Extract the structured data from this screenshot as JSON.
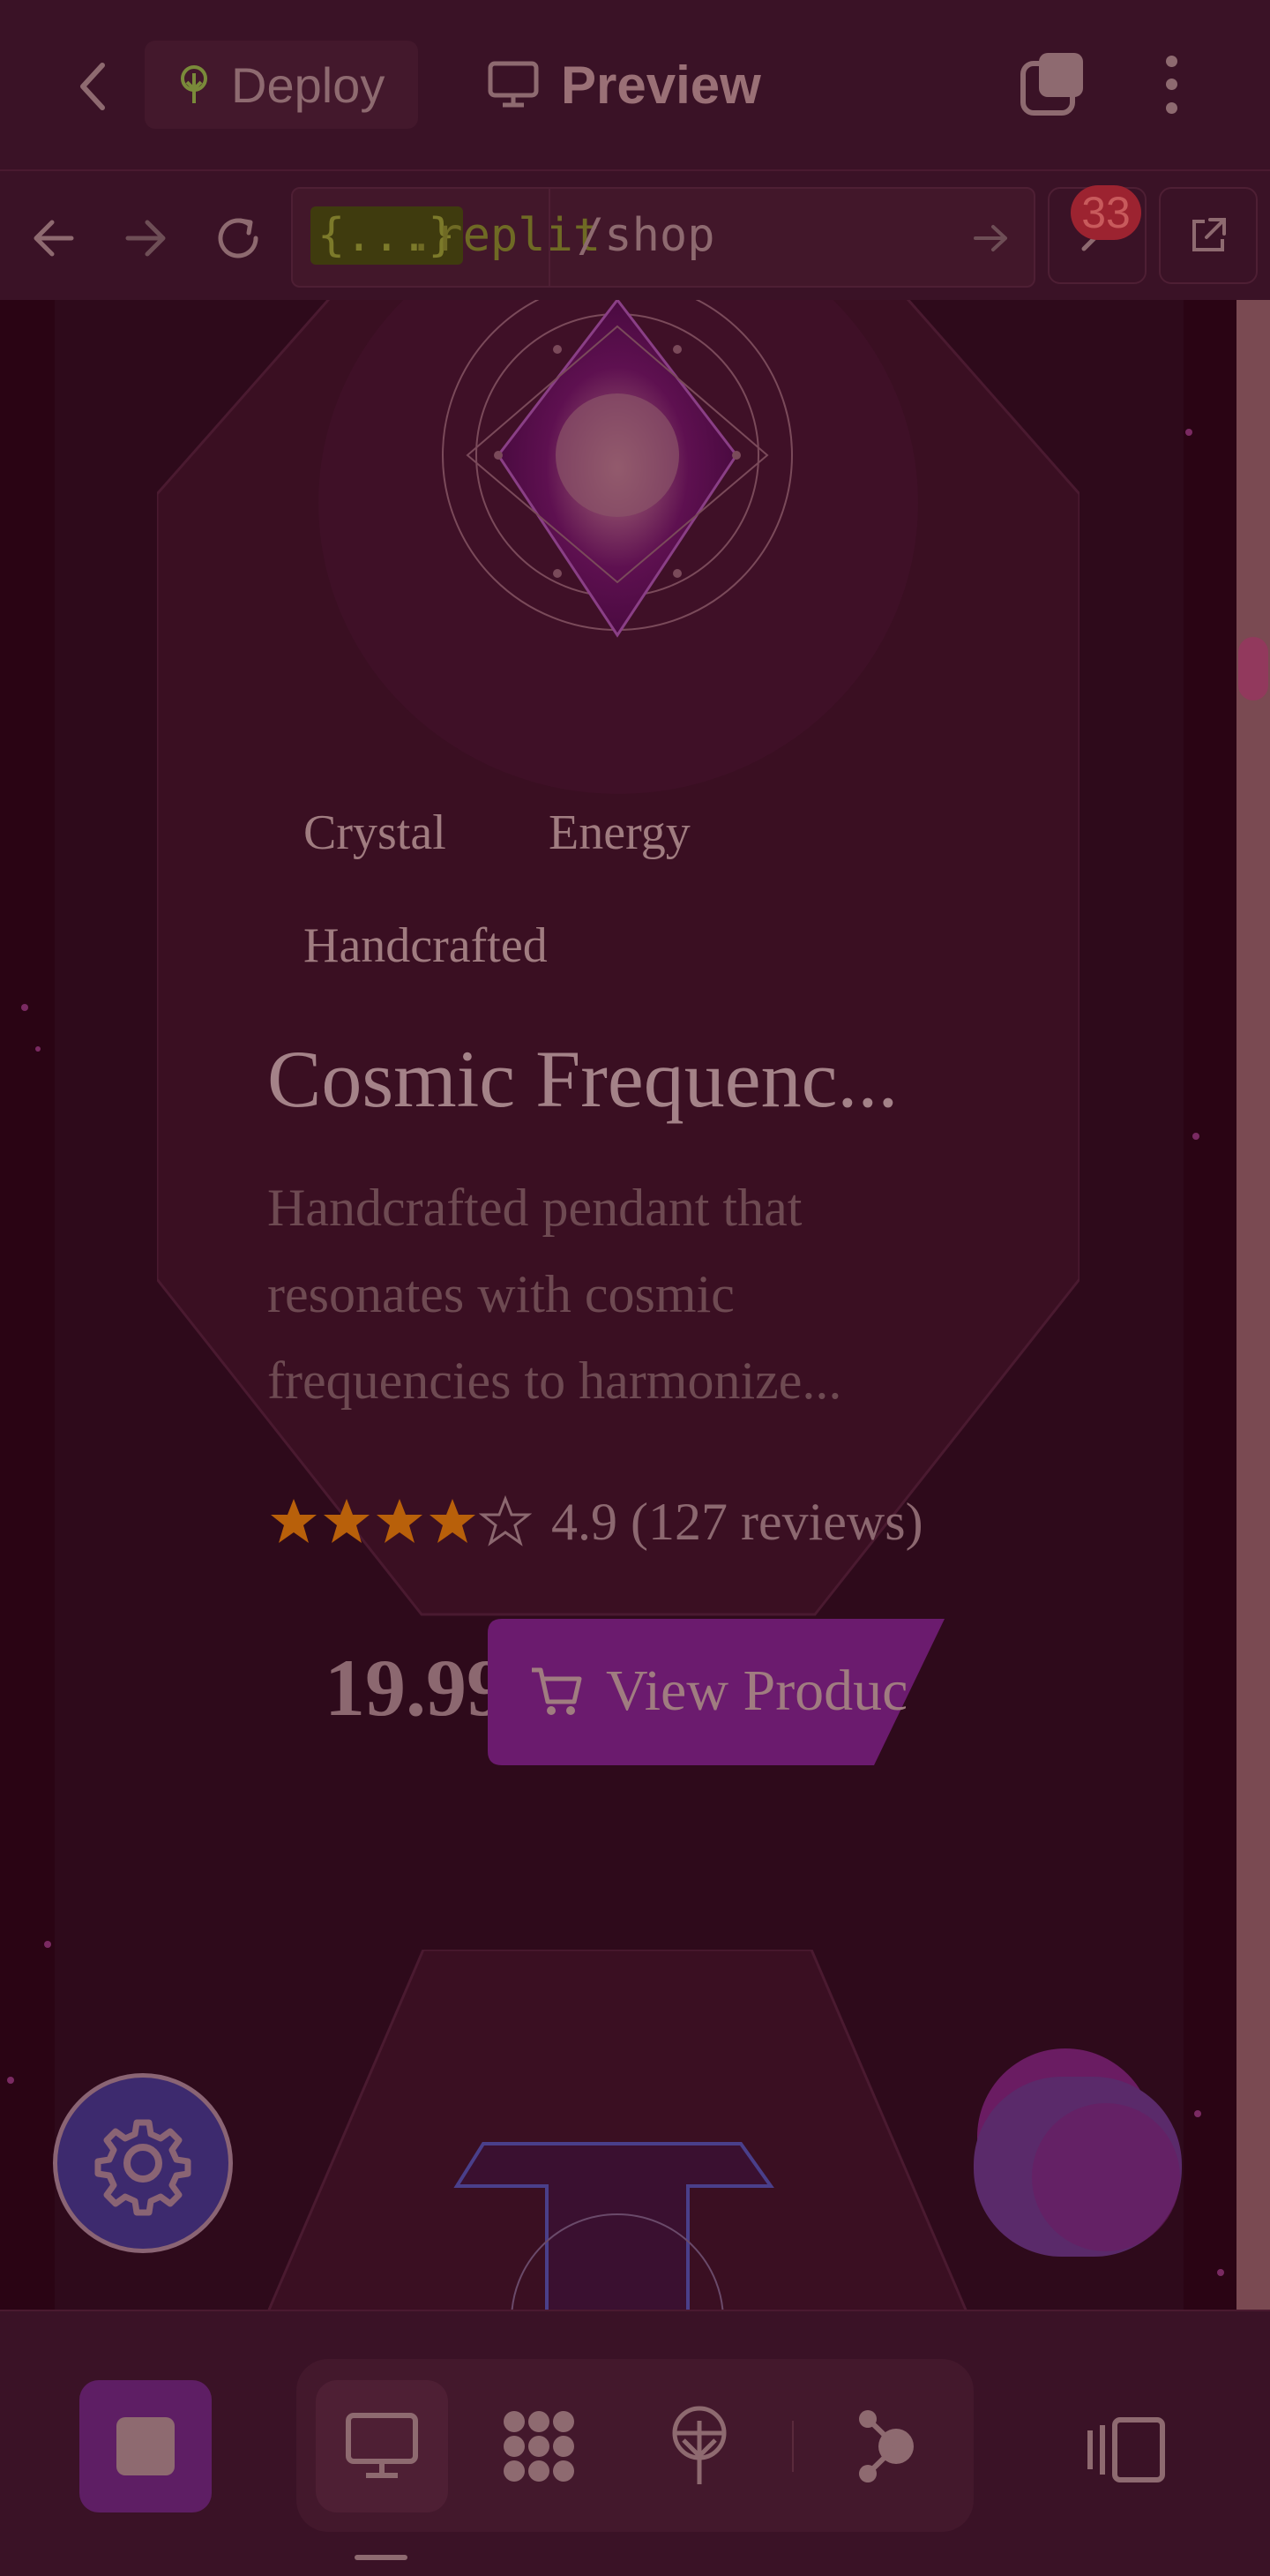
{
  "header": {
    "back_icon": "chevron-left-icon",
    "deploy_label": "Deploy",
    "deploy_icon": "deploy-tree-icon",
    "preview_label": "Preview",
    "preview_icon": "monitor-icon",
    "windows_icon": "windows-stack-icon",
    "menu_icon": "kebab-menu-icon"
  },
  "urlbar": {
    "host_prefix": "{...}",
    "host_suffix": ".replit",
    "path": "/shop",
    "devtools_badge_count": "33",
    "icons": [
      "back-arrow-icon",
      "forward-arrow-icon",
      "reload-icon",
      "go-arrow-icon",
      "devtools-icon",
      "external-link-icon"
    ]
  },
  "product": {
    "tags": [
      "Crystal",
      "Energy",
      "Handcrafted"
    ],
    "title": "Cosmic Frequenc...",
    "description": "Handcrafted pendant that resonates with cosmic frequencies to harmonize...",
    "rating_value": 4,
    "rating_max": 5,
    "rating_text": "4.9 (127 reviews)",
    "price": "19.99",
    "cta_label": "View Produc"
  },
  "bottom": {
    "stop_icon": "stop-square-icon",
    "tools": [
      "preview-monitor-icon",
      "integrations-icon",
      "deploy-icon",
      "agent-icon"
    ],
    "layout_icon": "split-layout-icon"
  },
  "colors": {
    "accent_purple": "#6b1b6e",
    "star_gold": "#b8600a",
    "badge_red": "#9c2330"
  }
}
